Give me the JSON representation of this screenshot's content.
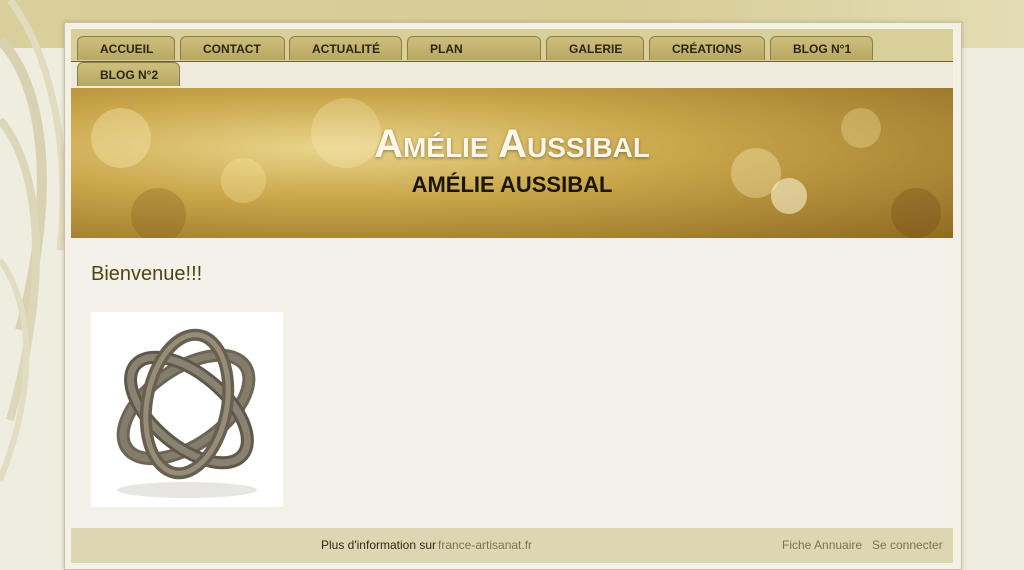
{
  "nav": {
    "tabs": [
      {
        "label": "ACCUEIL"
      },
      {
        "label": "CONTACT"
      },
      {
        "label": "ACTUALITÉ"
      },
      {
        "label": "PLAN"
      },
      {
        "label": "GALERIE"
      },
      {
        "label": "CRÉATIONS"
      },
      {
        "label": "BLOG N°1"
      },
      {
        "label": "BLOG N°2"
      }
    ]
  },
  "header": {
    "title": "Amélie Aussibal",
    "subtitle": "AMÉLIE AUSSIBAL"
  },
  "main": {
    "heading": "Bienvenue!!!"
  },
  "footer": {
    "info_prefix": "Plus d'information sur",
    "info_link": "france-artisanat.fr",
    "directory_link": "Fiche Annuaire",
    "login_link": "Se connecter"
  },
  "colors": {
    "accent": "#c4b46e",
    "heading": "#4d4613",
    "link": "#7c7352"
  }
}
